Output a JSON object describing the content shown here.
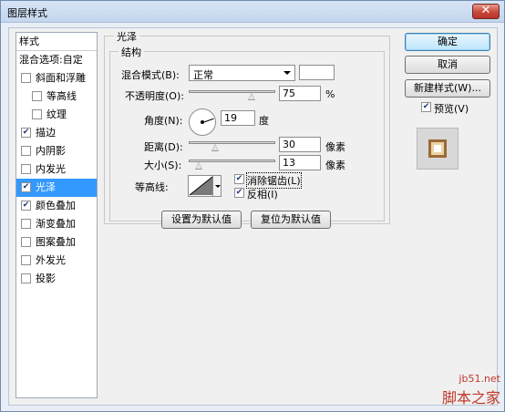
{
  "window": {
    "title": "图层样式",
    "close": "✕"
  },
  "styles": {
    "header": "样式",
    "blend_options": "混合选项:自定",
    "items": [
      {
        "label": "斜面和浮雕",
        "checked": false
      },
      {
        "label": "等高线",
        "checked": false,
        "indent": true
      },
      {
        "label": "纹理",
        "checked": false,
        "indent": true
      },
      {
        "label": "描边",
        "checked": true
      },
      {
        "label": "内阴影",
        "checked": false
      },
      {
        "label": "内发光",
        "checked": false
      },
      {
        "label": "光泽",
        "checked": true,
        "selected": true
      },
      {
        "label": "颜色叠加",
        "checked": true
      },
      {
        "label": "渐变叠加",
        "checked": false
      },
      {
        "label": "图案叠加",
        "checked": false
      },
      {
        "label": "外发光",
        "checked": false
      },
      {
        "label": "投影",
        "checked": false
      }
    ]
  },
  "satin": {
    "group_title": "光泽",
    "structure_title": "结构",
    "blend_mode_label": "混合模式(B):",
    "blend_mode_value": "正常",
    "opacity_label": "不透明度(O):",
    "opacity_value": "75",
    "opacity_unit": "%",
    "angle_label": "角度(N):",
    "angle_value": "19",
    "angle_unit": "度",
    "distance_label": "距离(D):",
    "distance_value": "30",
    "distance_unit": "像素",
    "size_label": "大小(S):",
    "size_value": "13",
    "size_unit": "像素",
    "contour_label": "等高线:",
    "anti_alias_label": "消除锯齿(L)",
    "anti_alias_checked": true,
    "invert_label": "反相(I)",
    "invert_checked": true,
    "set_default": "设置为默认值",
    "reset_default": "复位为默认值"
  },
  "actions": {
    "ok": "确定",
    "cancel": "取消",
    "new_style": "新建样式(W)...",
    "preview_label": "预览(V)",
    "preview_checked": true
  },
  "watermark": {
    "site": "jb51.net",
    "name": "脚本之家"
  },
  "colors": {
    "selection": "#3399ff",
    "accent": "#3c7fb1"
  }
}
